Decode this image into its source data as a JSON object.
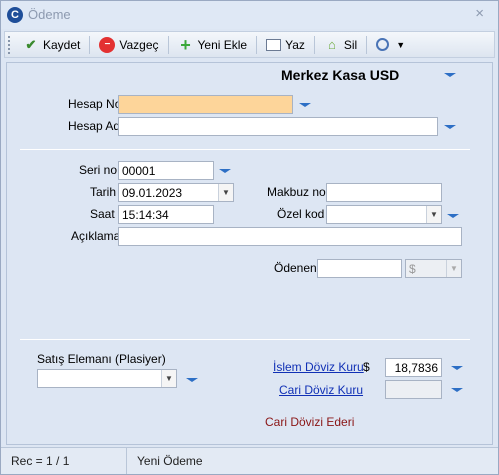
{
  "window": {
    "title": "Ödeme",
    "app_icon_letter": "C",
    "close_symbol": "×"
  },
  "toolbar": {
    "kaydet": "Kaydet",
    "vazgec": "Vazgeç",
    "yeni_ekle": "Yeni Ekle",
    "yaz": "Yaz",
    "sil": "Sil"
  },
  "heading": "Merkez Kasa USD",
  "account": {
    "hesap_no_label": "Hesap No",
    "hesap_no_value": "",
    "hesap_adi_label": "Hesap Adı",
    "hesap_adi_value": ""
  },
  "form": {
    "seri_no_label": "Seri no",
    "seri_no_value": "00001",
    "tarih_label": "Tarih",
    "tarih_value": "09.01.2023",
    "saat_label": "Saat",
    "saat_value": "15:14:34",
    "makbuz_no_label": "Makbuz no",
    "makbuz_no_value": "",
    "ozel_kod_label": "Özel kod",
    "ozel_kod_value": "",
    "aciklama_label": "Açıklama",
    "aciklama_value": "",
    "odenen_label": "Ödenen",
    "odenen_value": "",
    "currency_value": "$"
  },
  "lower": {
    "satis_elemani_label": "Satış Elemanı (Plasiyer)",
    "satis_elemani_value": "",
    "islem_doviz_label": "İslem Döviz Kuru",
    "currency_symbol": "$",
    "islem_doviz_value": "18,7836",
    "cari_doviz_label": "Cari Döviz Kuru",
    "cari_doviz_value": "",
    "cari_dovizi_ederi": "Cari Dövizi Ederi"
  },
  "status": {
    "record": "Rec = 1 / 1",
    "mode": "Yeni Ödeme"
  },
  "colors": {
    "accent": "#2d6fc5",
    "highlight_field": "#fdd59a",
    "link": "#1030b5",
    "warning_text": "#8a1515"
  }
}
